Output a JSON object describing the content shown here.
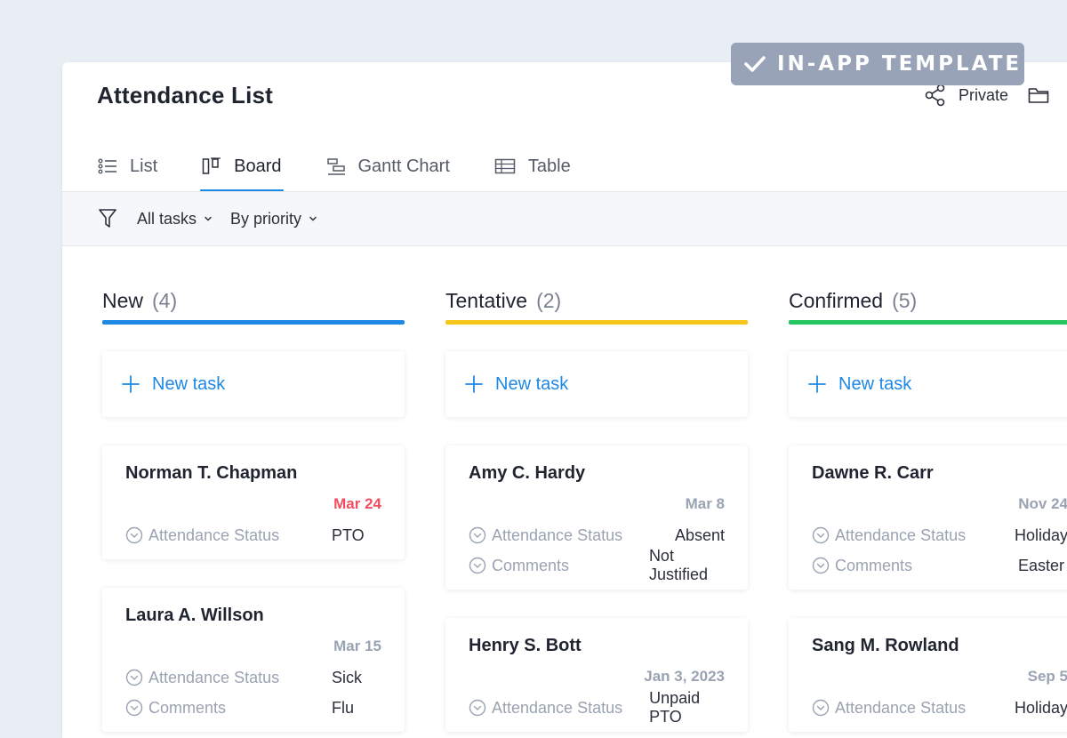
{
  "badge": {
    "label": "IN-APP TEMPLATE",
    "icon": "check-icon"
  },
  "header": {
    "title": "Attendance List",
    "privacy_label": "Private",
    "share_icon": "share-icon",
    "folder_icon": "folder-icon"
  },
  "tabs": [
    {
      "label": "List",
      "icon": "list-icon",
      "active": false
    },
    {
      "label": "Board",
      "icon": "board-icon",
      "active": true
    },
    {
      "label": "Gantt Chart",
      "icon": "gantt-icon",
      "active": false
    },
    {
      "label": "Table",
      "icon": "table-icon",
      "active": false
    }
  ],
  "filters": {
    "icon": "filter-icon",
    "scope": "All tasks",
    "grouping": "By priority"
  },
  "colors": {
    "accent": "#1e88e5",
    "overdue": "#f04e5e",
    "new": "#1e88e5",
    "tentative": "#f5c518",
    "confirmed": "#22c55e"
  },
  "columns": [
    {
      "title": "New",
      "count": "(4)",
      "new_task": "New task",
      "cards": [
        {
          "name": "Norman T. Chapman",
          "date": "Mar 24",
          "overdue": true,
          "fields": [
            {
              "label": "Attendance Status",
              "value": "PTO"
            }
          ]
        },
        {
          "name": "Laura A. Willson",
          "date": "Mar 15",
          "overdue": false,
          "fields": [
            {
              "label": "Attendance Status",
              "value": "Sick"
            },
            {
              "label": "Comments",
              "value": "Flu"
            }
          ]
        }
      ]
    },
    {
      "title": "Tentative",
      "count": "(2)",
      "new_task": "New task",
      "cards": [
        {
          "name": "Amy C. Hardy",
          "date": "Mar 8",
          "overdue": false,
          "fields": [
            {
              "label": "Attendance Status",
              "value": "Absent"
            },
            {
              "label": "Comments",
              "value": "Not Justified"
            }
          ]
        },
        {
          "name": "Henry S. Bott",
          "date": "Jan 3, 2023",
          "overdue": false,
          "fields": [
            {
              "label": "Attendance Status",
              "value": "Unpaid PTO"
            }
          ]
        }
      ]
    },
    {
      "title": "Confirmed",
      "count": "(5)",
      "new_task": "New task",
      "cards": [
        {
          "name": "Dawne R. Carr",
          "date": "Nov 24",
          "overdue": false,
          "fields": [
            {
              "label": "Attendance Status",
              "value": "Holiday"
            },
            {
              "label": "Comments",
              "value": "Easter"
            }
          ]
        },
        {
          "name": "Sang M. Rowland",
          "date": "Sep 5",
          "overdue": false,
          "fields": [
            {
              "label": "Attendance Status",
              "value": "Holiday"
            }
          ]
        }
      ]
    }
  ]
}
